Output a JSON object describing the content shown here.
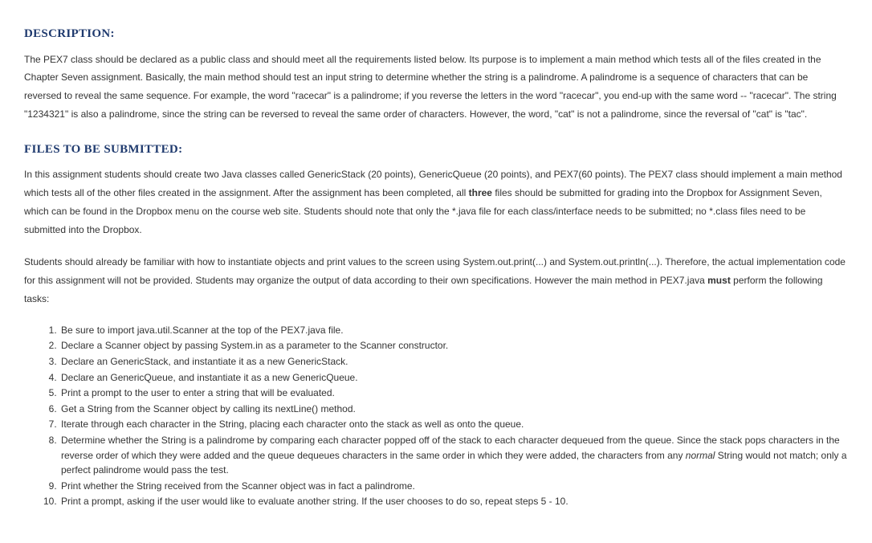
{
  "sections": {
    "description": {
      "heading": "DESCRIPTION:",
      "body": "The PEX7 class should be declared as a public class and should meet all the requirements listed below. Its purpose is to implement a main method which tests all of the files created in the Chapter Seven assignment. Basically, the main method should test an input string to determine whether the string is a palindrome. A palindrome is a sequence of characters that can be reversed to reveal the same sequence. For example, the word \"racecar\" is a palindrome; if you reverse the letters in the word \"racecar\", you end-up with the same word -- \"racecar\". The string \"1234321\" is also a palindrome, since the string can be reversed to reveal the same order of characters. However, the word, \"cat\" is not a palindrome, since the reversal of \"cat\" is \"tac\"."
    },
    "files": {
      "heading": "FILES TO BE SUBMITTED:",
      "para1_a": "In this assignment students should create two Java classes called GenericStack (20 points), GenericQueue (20 points), and PEX7(60 points). The PEX7 class should implement a main method which tests all of the other files created in the assignment. After the assignment has been completed, all ",
      "para1_bold": "three",
      "para1_b": " files should be submitted for grading into the Dropbox for Assignment Seven, which can be found in the Dropbox menu on the course web site. Students should note that only the *.java file for each class/interface needs to be submitted; no *.class files need to be submitted into the Dropbox.",
      "para2_a": "Students should already be familiar with how to instantiate objects and print values to the screen using System.out.print(...) and System.out.println(...). Therefore, the actual implementation code for this assignment will not be provided. Students may organize the output of data according to their own specifications. However the main method in PEX7.java ",
      "para2_bold": "must",
      "para2_b": " perform the following tasks:",
      "steps": [
        "Be sure to import java.util.Scanner at the top of the PEX7.java file.",
        "Declare a Scanner object by passing System.in as a parameter to the Scanner constructor.",
        "Declare an GenericStack, and instantiate it as a new GenericStack.",
        "Declare an GenericQueue, and instantiate it as a new GenericQueue.",
        "Print a prompt to the user to enter a string that will be evaluated.",
        "Get a String from the Scanner object by calling its nextLine() method.",
        "Iterate through each character in the String, placing each character onto the stack as well as onto the queue."
      ],
      "step8_a": "Determine whether the String is a palindrome by comparing each character popped off of the stack to each character dequeued from the queue. Since the stack pops characters in the reverse order of which they were added and the queue dequeues characters in the same order in which they were added, the characters from any ",
      "step8_italic": "normal",
      "step8_b": " String would not match; only a perfect palindrome would pass the test.",
      "step9": "Print whether the String received from the Scanner object was in fact a palindrome.",
      "step10": "Print a prompt, asking if the user would like to evaluate another string. If the user chooses to do so, repeat steps 5 - 10."
    }
  }
}
